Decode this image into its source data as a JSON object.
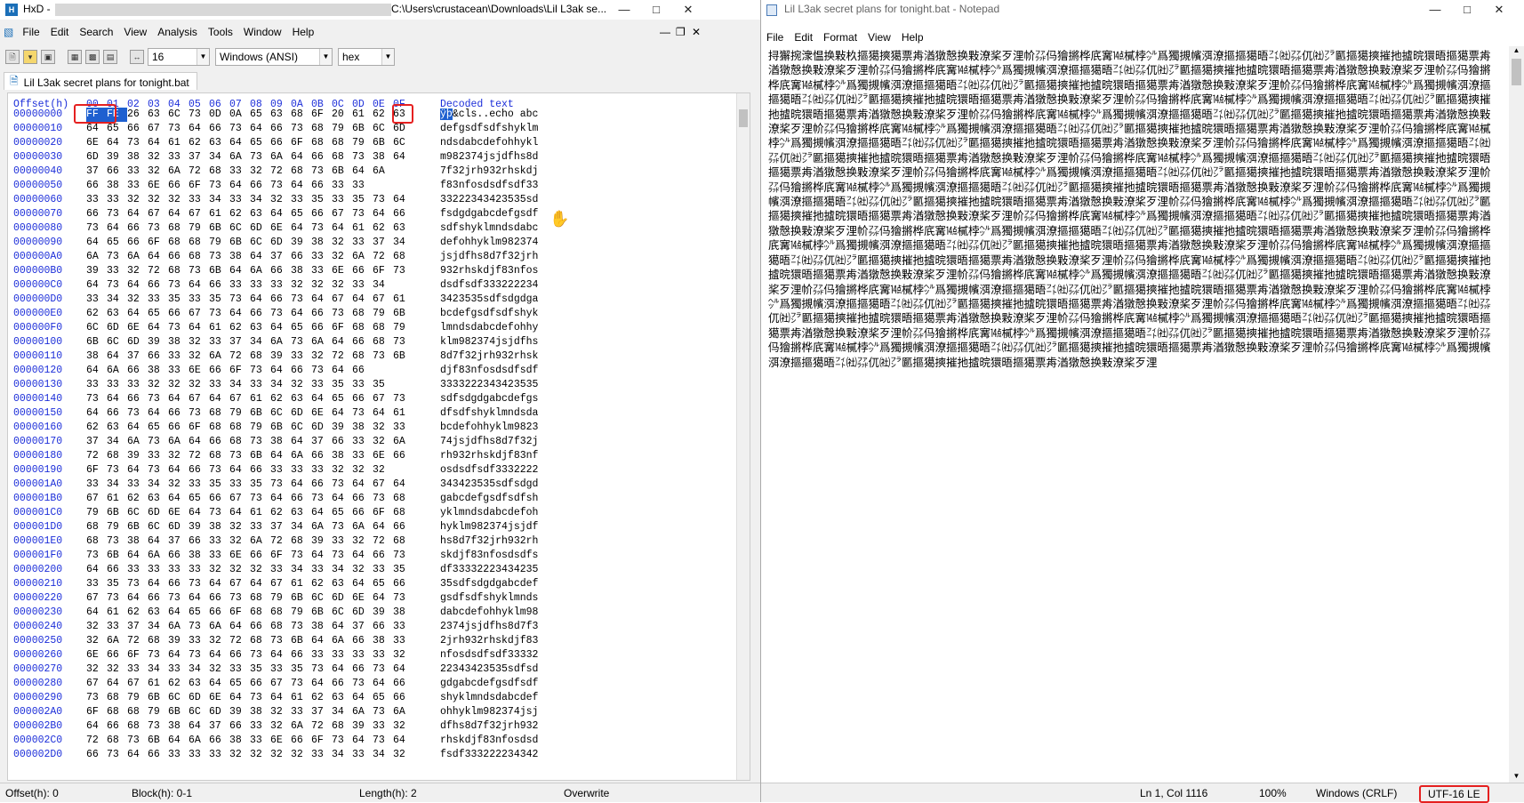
{
  "hxd": {
    "title": "HxD - ",
    "title_path": "C:\\Users\\crustacean\\Downloads\\Lil L3ak se...",
    "menu": [
      "File",
      "Edit",
      "Search",
      "View",
      "Analysis",
      "Tools",
      "Window",
      "Help"
    ],
    "toolbar": {
      "bytes_per_row": "16",
      "charset": "Windows (ANSI)",
      "view": "hex"
    },
    "tab": "Lil L3ak secret plans for tonight.bat",
    "header": {
      "offset": "Offset(h)",
      "cols": "00 01 02 03 04 05 06 07 08 09 0A 0B 0C 0D 0E 0F",
      "decoded": "Decoded text"
    },
    "rows": [
      {
        "off": "00000000",
        "hex": "FF FE 26 63 6C 73 0D 0A 65 63 68 6F 20 61 62 63",
        "txt": "&cls..echo abc"
      },
      {
        "off": "00000010",
        "hex": "64 65 66 67 73 64 66 73 64 66 73 68 79 6B 6C 6D",
        "txt": "defgsdfsdfshyklm"
      },
      {
        "off": "00000020",
        "hex": "6E 64 73 64 61 62 63 64 65 66 6F 68 68 79 6B 6C",
        "txt": "ndsdabcdefohhykl"
      },
      {
        "off": "00000030",
        "hex": "6D 39 38 32 33 37 34 6A 73 6A 64 66 68 73 38 64",
        "txt": "m982374jsjdfhs8d"
      },
      {
        "off": "00000040",
        "hex": "37 66 33 32 6A 72 68 33 32 72 68 73 6B 64 6A",
        "txt": "7f32jrh932rhskdj"
      },
      {
        "off": "00000050",
        "hex": "66 38 33 6E 66 6F 73 64 66 73 64 66 33 33",
        "txt": "f83nfosdsdfsdf33"
      },
      {
        "off": "00000060",
        "hex": "33 33 32 32 32 33 34 33 34 32 33 35 33 35 73 64",
        "txt": "33222343423535sd"
      },
      {
        "off": "00000070",
        "hex": "66 73 64 67 64 67 61 62 63 64 65 66 67 73 64 66",
        "txt": "fsdgdgabcdefgsdf"
      },
      {
        "off": "00000080",
        "hex": "73 64 66 73 68 79 6B 6C 6D 6E 64 73 64 61 62 63",
        "txt": "sdfshyklmndsdabc"
      },
      {
        "off": "00000090",
        "hex": "64 65 66 6F 68 68 79 6B 6C 6D 39 38 32 33 37 34",
        "txt": "defohhyklm982374"
      },
      {
        "off": "000000A0",
        "hex": "6A 73 6A 64 66 68 73 38 64 37 66 33 32 6A 72 68",
        "txt": "jsjdfhs8d7f32jrh"
      },
      {
        "off": "000000B0",
        "hex": "39 33 32 72 68 73 6B 64 6A 66 38 33 6E 66 6F 73",
        "txt": "932rhskdjf83nfos"
      },
      {
        "off": "000000C0",
        "hex": "64 73 64 66 73 64 66 33 33 33 32 32 32 33 34",
        "txt": "dsdfsdf333222234"
      },
      {
        "off": "000000D0",
        "hex": "33 34 32 33 35 33 35 73 64 66 73 64 67 64 67 61",
        "txt": "3423535sdfsdgdga"
      },
      {
        "off": "000000E0",
        "hex": "62 63 64 65 66 67 73 64 66 73 64 66 73 68 79 6B",
        "txt": "bcdefgsdfsdfshyk"
      },
      {
        "off": "000000F0",
        "hex": "6C 6D 6E 64 73 64 61 62 63 64 65 66 6F 68 68 79",
        "txt": "lmndsdabcdefohhy"
      },
      {
        "off": "00000100",
        "hex": "6B 6C 6D 39 38 32 33 37 34 6A 73 6A 64 66 68 73",
        "txt": "klm982374jsjdfhs"
      },
      {
        "off": "00000110",
        "hex": "38 64 37 66 33 32 6A 72 68 39 33 32 72 68 73 6B",
        "txt": "8d7f32jrh932rhsk"
      },
      {
        "off": "00000120",
        "hex": "64 6A 66 38 33 6E 66 6F 73 64 66 73 64 66",
        "txt": "djf83nfosdsdfsdf"
      },
      {
        "off": "00000130",
        "hex": "33 33 33 32 32 32 33 34 33 34 32 33 35 33 35",
        "txt": "3333222343423535"
      },
      {
        "off": "00000140",
        "hex": "73 64 66 73 64 67 64 67 61 62 63 64 65 66 67 73",
        "txt": "sdfsdgdgabcdefgs"
      },
      {
        "off": "00000150",
        "hex": "64 66 73 64 66 73 68 79 6B 6C 6D 6E 64 73 64 61",
        "txt": "dfsdfshyklmndsda"
      },
      {
        "off": "00000160",
        "hex": "62 63 64 65 66 6F 68 68 79 6B 6C 6D 39 38 32 33",
        "txt": "bcdefohhyklm9823"
      },
      {
        "off": "00000170",
        "hex": "37 34 6A 73 6A 64 66 68 73 38 64 37 66 33 32 6A",
        "txt": "74jsjdfhs8d7f32j"
      },
      {
        "off": "00000180",
        "hex": "72 68 39 33 32 72 68 73 6B 64 6A 66 38 33 6E 66",
        "txt": "rh932rhskdjf83nf"
      },
      {
        "off": "00000190",
        "hex": "6F 73 64 73 64 66 73 64 66 33 33 33 32 32 32",
        "txt": "osdsdfsdf3332222"
      },
      {
        "off": "000001A0",
        "hex": "33 34 33 34 32 33 35 33 35 73 64 66 73 64 67 64",
        "txt": "343423535sdfsdgd"
      },
      {
        "off": "000001B0",
        "hex": "67 61 62 63 64 65 66 67 73 64 66 73 64 66 73 68",
        "txt": "gabcdefgsdfsdfsh"
      },
      {
        "off": "000001C0",
        "hex": "79 6B 6C 6D 6E 64 73 64 61 62 63 64 65 66 6F 68",
        "txt": "yklmndsdabcdefoh"
      },
      {
        "off": "000001D0",
        "hex": "68 79 6B 6C 6D 39 38 32 33 37 34 6A 73 6A 64 66",
        "txt": "hyklm982374jsjdf"
      },
      {
        "off": "000001E0",
        "hex": "68 73 38 64 37 66 33 32 6A 72 68 39 33 32 72 68",
        "txt": "hs8d7f32jrh932rh"
      },
      {
        "off": "000001F0",
        "hex": "73 6B 64 6A 66 38 33 6E 66 6F 73 64 73 64 66 73",
        "txt": "skdjf83nfosdsdfs"
      },
      {
        "off": "00000200",
        "hex": "64 66 33 33 33 33 32 32 32 33 34 33 34 32 33 35",
        "txt": "df33332223434235"
      },
      {
        "off": "00000210",
        "hex": "33 35 73 64 66 73 64 67 64 67 61 62 63 64 65 66",
        "txt": "35sdfsdgdgabcdef"
      },
      {
        "off": "00000220",
        "hex": "67 73 64 66 73 64 66 73 68 79 6B 6C 6D 6E 64 73",
        "txt": "gsdfsdfshyklmnds"
      },
      {
        "off": "00000230",
        "hex": "64 61 62 63 64 65 66 6F 68 68 79 6B 6C 6D 39 38",
        "txt": "dabcdefohhyklm98"
      },
      {
        "off": "00000240",
        "hex": "32 33 37 34 6A 73 6A 64 66 68 73 38 64 37 66 33",
        "txt": "2374jsjdfhs8d7f3"
      },
      {
        "off": "00000250",
        "hex": "32 6A 72 68 39 33 32 72 68 73 6B 64 6A 66 38 33",
        "txt": "2jrh932rhskdjf83"
      },
      {
        "off": "00000260",
        "hex": "6E 66 6F 73 64 73 64 66 73 64 66 33 33 33 33 32",
        "txt": "nfosdsdfsdf33332"
      },
      {
        "off": "00000270",
        "hex": "32 32 33 34 33 34 32 33 35 33 35 73 64 66 73 64",
        "txt": "22343423535sdfsd"
      },
      {
        "off": "00000280",
        "hex": "67 64 67 61 62 63 64 65 66 67 73 64 66 73 64 66",
        "txt": "gdgabcdefgsdfsdf"
      },
      {
        "off": "00000290",
        "hex": "73 68 79 6B 6C 6D 6E 64 73 64 61 62 63 64 65 66",
        "txt": "shyklmndsdabcdef"
      },
      {
        "off": "000002A0",
        "hex": "6F 68 68 79 6B 6C 6D 39 38 32 33 37 34 6A 73 6A",
        "txt": "ohhyklm982374jsj"
      },
      {
        "off": "000002B0",
        "hex": "64 66 68 73 38 64 37 66 33 32 6A 72 68 39 33 32",
        "txt": "dfhs8d7f32jrh932"
      },
      {
        "off": "000002C0",
        "hex": "72 68 73 6B 64 6A 66 38 33 6E 66 6F 73 64 73 64",
        "txt": "rhskdjf83nfosdsd"
      },
      {
        "off": "000002D0",
        "hex": "66 73 64 66 33 33 33 32 32 32 32 33 34 33 34 32",
        "txt": "fsdf333222234342"
      }
    ],
    "status": {
      "offset": "Offset(h): 0",
      "block": "Block(h): 0-1",
      "length": "Length(h): 2",
      "mode": "Overwrite"
    }
  },
  "notepad": {
    "title": "Lil L3ak secret plans for tonight.bat - Notepad",
    "menu": [
      "File",
      "Edit",
      "Format",
      "View",
      "Help"
    ],
    "content": "挦獬਍捥潨愠换敤杦摳獦摤獦票歬湭獤慤换敤潦桨歹浬㠹㌲㐷獪摪桦㡳㝤㍦樲桲㌹爲獨摫㡦渳潦摳摳獦晤㌳㈳㌲㐳㈳㌵㔳摳獦摤摧扡摣晥獧晤摳獦票歬湭獤慤换敤潦桨歹浬㠹㌲㐷獪摪桦㡳㝤㍦樲桲㌹爲獨摫㡦渳潦摳摳獦晤㌳㈳㌲㐳㈳㌵㔳摳獦摤摧扡摣晥獧晤摳獦票歬湭獤慤换敤潦桨歹浬㠹㌲㐷獪摪桦㡳㝤㍦樲桲㌹爲獨摫㡦渳潦摳摳獦晤㌳㈳㌲㐳㈳㌵㔳摳獦摤摧扡摣晥獧晤摳獦票歬湭獤慤换敤潦桨歹浬㠹㌲㐷獪摪桦㡳㝤㍦樲桲㌹爲獨摫㡦渳潦摳摳獦晤㌳㈳㌲㐳㈳㌵㔳摳獦摤摧扡摣晥獧晤摳獦票歬湭獤慤换敤潦桨歹浬㠹㌲㐷獪摪桦㡳㝤㍦樲桲㌹爲獨摫㡦渳潦摳摳獦晤㌳㈳㌲㐳㈳㌵㔳摳獦摤摧扡摣晥獧晤摳獦票歬湭獤慤换敤潦桨歹浬㠹㌲㐷獪摪桦㡳㝤㍦樲桲㌹爲獨摫㡦渳潦摳摳獦晤㌳㈳㌲㐳㈳㌵㔳摳獦摤摧扡摣晥獧晤摳獦票歬湭獤慤换敤潦桨歹浬㠹㌲㐷獪摪桦㡳㝤㍦樲桲㌹爲獨摫㡦渳潦摳摳獦晤㌳㈳㌲㐳㈳㌵㔳摳獦摤摧扡摣晥獧晤摳獦票歬湭獤慤换敤潦桨歹浬㠹㌲㐷獪摪桦㡳㝤㍦樲桲㌹爲獨摫㡦渳潦摳摳獦晤㌳㈳㌲㐳㈳㌵㔳摳獦摤摧扡摣晥獧晤摳獦票歬湭獤慤换敤潦桨歹浬㠹㌲㐷獪摪桦㡳㝤㍦樲桲㌹爲獨摫㡦渳潦摳摳獦晤㌳㈳㌲㐳㈳㌵㔳摳獦摤摧扡摣晥獧晤摳獦票歬湭獤慤换敤潦桨歹浬㠹㌲㐷獪摪桦㡳㝤㍦樲桲㌹爲獨摫㡦渳潦摳摳獦晤㌳㈳㌲㐳㈳㌵㔳摳獦摤摧扡摣晥獧晤摳獦票歬湭獤慤换敤潦桨歹浬㠹㌲㐷獪摪桦㡳㝤㍦樲桲㌹爲獨摫㡦渳潦摳摳獦晤㌳㈳㌲㐳㈳㌵㔳摳獦摤摧扡摣晥獧晤摳獦票歬湭獤慤换敤潦桨歹浬㠹㌲㐷獪摪桦㡳㝤㍦樲桲㌹爲獨摫㡦渳潦摳摳獦晤㌳㈳㌲㐳㈳㌵㔳摳獦摤摧扡摣晥獧晤摳獦票歬湭獤慤换敤潦桨歹浬㠹㌲㐷獪摪桦㡳㝤㍦樲桲㌹爲獨摫㡦渳潦摳摳獦晤㌳㈳㌲㐳㈳㌵㔳摳獦摤摧扡摣晥獧晤摳獦票歬湭獤慤换敤潦桨歹浬㠹㌲㐷獪摪桦㡳㝤㍦樲桲㌹爲獨摫㡦渳潦摳摳獦晤㌳㈳㌲㐳㈳㌵㔳摳獦摤摧扡摣晥獧晤摳獦票歬湭獤慤换敤潦桨歹浬㠹㌲㐷獪摪桦㡳㝤㍦樲桲㌹爲獨摫㡦渳潦摳摳獦晤㌳㈳㌲㐳㈳㌵㔳摳獦摤摧扡摣晥獧晤摳獦票歬湭獤慤换敤潦桨歹浬㠹㌲㐷獪摪桦㡳㝤㍦樲桲㌹爲獨摫㡦渳潦摳摳獦晤㌳㈳㌲㐳㈳㌵㔳摳獦摤摧扡摣晥獧晤摳獦票歬湭獤慤换敤潦桨歹浬㠹㌲㐷獪摪桦㡳㝤㍦樲桲㌹爲獨摫㡦渳潦摳摳獦晤㌳㈳㌲㐳㈳㌵㔳摳獦摤摧扡摣晥獧晤摳獦票歬湭獤慤换敤潦桨歹浬㠹㌲㐷獪摪桦㡳㝤㍦樲桲㌹爲獨摫㡦渳潦摳摳獦晤㌳㈳㌲㐳㈳㌵㔳摳獦摤摧扡摣晥獧晤摳獦票歬湭獤慤换敤潦桨歹浬㠹㌲㐷獪摪桦㡳㝤㍦樲桲㌹爲獨摫㡦渳潦摳摳獦晤㌳㈳㌲㐳㈳㌵㔳摳獦摤摧扡摣晥獧晤摳獦票歬湭獤慤换敤潦桨歹浬㠹㌲㐷獪摪桦㡳㝤㍦樲桲㌹爲獨摫㡦渳潦摳摳獦晤㌳㈳㌲㐳㈳㌵㔳摳獦摤摧扡摣晥獧晤摳獦票歬湭獤慤换敤潦桨歹浬㠹㌲㐷獪摪桦㡳㝤㍦樲桲㌹爲獨摫㡦渳潦摳摳獦晤㌳㈳㌲㐳㈳㌵㔳摳獦摤摧扡摣晥獧晤摳獦票歬湭獤慤换敤潦桨歹浬㠹㌲㐷獪摪桦㡳㝤㍦樲桲㌹爲獨摫㡦渳潦摳摳獦晤㌳㈳㌲㐳㈳㌵㔳摳獦摤摧扡摣晥獧晤摳獦票歬湭獤慤换敤潦桨歹浬㠹㌲㐷獪摪桦㡳㝤㍦樲桲㌹爲獨摫㡦渳潦摳摳獦晤㌳㈳㌲㐳㈳㌵㔳摳獦摤摧扡摣晥獧晤摳獦票歬湭獤慤换敤潦桨歹浬㠹㌲㐷獪摪桦㡳㝤㍦樲桲㌹爲獨摫㡦渳潦摳摳獦晤㌳㈳㌲㐳㈳㌵㔳摳獦摤摧扡摣晥獧晤摳獦票歬湭獤慤换敤潦桨歹浬㠹㌲㐷獪摪桦㡳㝤㍦樲桲㌹爲獨摫㡦渳潦摳摳獦晤㌳㈳㌲㐳㈳㌵㔳摳獦摤摧扡摣晥獧晤摳獦票歬湭獤慤换敤潦桨歹浬㠹㌲㐷獪摪桦㡳㝤㍦樲桲㌹爲獨摫㡦渳潦摳摳獦晤㌳㈳㌲㐳㈳㌵㔳摳獦摤摧扡摣晥獧晤摳獦票歬湭獤慤换敤潦桨歹浬㠹㌲㐷獪摪桦㡳㝤㍦樲桲㌹爲獨摫㡦渳潦摳摳獦晤㌳㈳㌲㐳㈳㌵㔳摳獦摤摧扡摣晥獧晤摳獦票歬湭獤慤换敤潦桨歹浬",
    "status": {
      "position": "Ln 1, Col 1116",
      "zoom": "100%",
      "eol": "Windows (CRLF)",
      "encoding": "UTF-16 LE"
    }
  },
  "colors": {
    "offset_blue": "#1c2ed9",
    "selection": "#1e60d0",
    "highlight_red": "#e52020"
  }
}
